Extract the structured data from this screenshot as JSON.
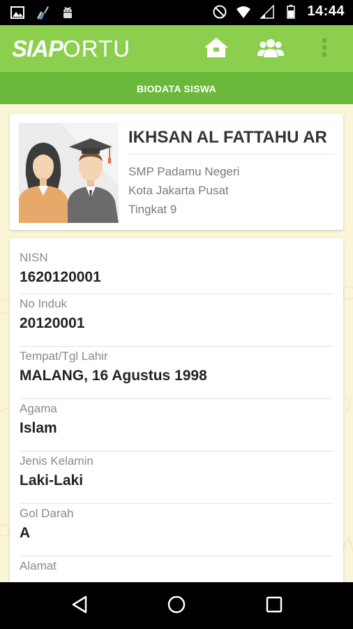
{
  "status_bar": {
    "time": "14:44",
    "left_icons": [
      "gallery-icon",
      "cleaner-icon",
      "android-icon"
    ],
    "right_icons": [
      "do-not-disturb-icon",
      "wifi-icon",
      "signal-icon",
      "battery-icon"
    ]
  },
  "app_bar": {
    "logo_siap": "SIAP",
    "logo_ortu": "ORTU",
    "actions": [
      "home-icon",
      "group-icon",
      "overflow-menu-icon"
    ],
    "color": "#8ccf4f"
  },
  "sub_header": {
    "title": "BIODATA SISWA",
    "color": "#6ab93a"
  },
  "profile": {
    "name": "IKHSAN AL FATTAHU AR",
    "school": "SMP Padamu Negeri",
    "city": "Kota Jakarta Pusat",
    "grade": "Tingkat 9"
  },
  "details": [
    {
      "label": "NISN",
      "value": "1620120001"
    },
    {
      "label": "No Induk",
      "value": "20120001"
    },
    {
      "label": "Tempat/Tgl Lahir",
      "value": "MALANG, 16 Agustus 1998"
    },
    {
      "label": "Agama",
      "value": "Islam"
    },
    {
      "label": "Jenis Kelamin",
      "value": "Laki-Laki"
    },
    {
      "label": "Gol Darah",
      "value": "A"
    },
    {
      "label": "Alamat",
      "value": ""
    }
  ],
  "nav_bar": {
    "buttons": [
      "back-icon",
      "home-circle-icon",
      "recents-icon"
    ]
  }
}
